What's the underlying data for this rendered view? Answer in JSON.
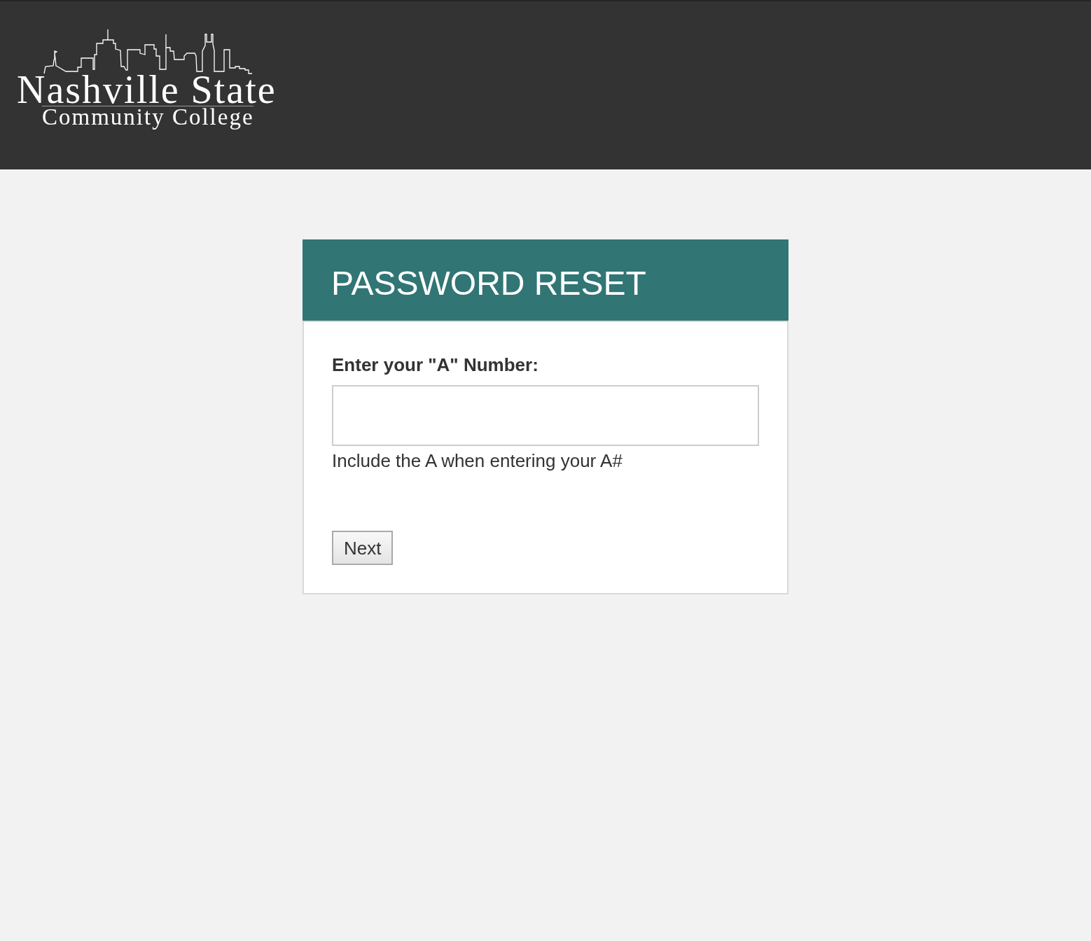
{
  "header": {
    "logo": {
      "title": "Nashville State",
      "subtitle": "Community College"
    }
  },
  "card": {
    "title": "PASSWORD RESET",
    "field": {
      "label": "Enter your \"A\" Number:",
      "hint": "Include the A when entering your A#"
    },
    "submit_button": {
      "label": "Next"
    }
  }
}
